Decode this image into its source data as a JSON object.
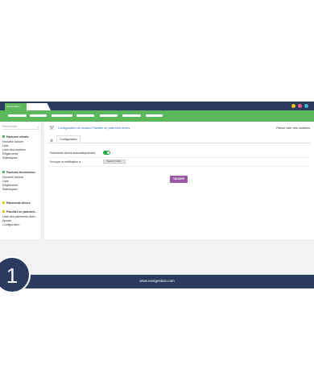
{
  "app": {
    "brand_tab": "NextGestion"
  },
  "window_dots": [
    "#f1c40f",
    "#e85d8a",
    "#3fb2d6"
  ],
  "sidebar": {
    "search_placeholder": "Rechercher",
    "sections": [
      {
        "title": "Factures clients",
        "color": "#5cb85c",
        "items": [
          "Nouvelle facture",
          "Liste",
          "Liste des modèles",
          "Règlements",
          "Statistiques"
        ]
      },
      {
        "title": "Factures fournisseur",
        "color": "#5cb85c",
        "items": [
          "Nouvelle facture",
          "Liste",
          "Règlements",
          "Statistiques"
        ]
      },
      {
        "title": "Paiements divers",
        "color": "#f1c40f",
        "items": []
      },
      {
        "title": "Planifier un paiemen...",
        "color": "#f1c40f",
        "items": [
          "Liste des paiements diver...",
          "Ajouter",
          "Configuration"
        ]
      }
    ]
  },
  "main": {
    "title": "Configuration du module Planifier un paiement divers",
    "back_link": "Retour liste des modules",
    "tab_label": "Configuration",
    "rows": [
      {
        "label": "Paiements divers automatiquement",
        "toggle_on": true
      },
      {
        "label": "Envoyer la notification à",
        "select_value": "- Selectz Utilis"
      }
    ],
    "validate_label": "VALIDER"
  },
  "footer": {
    "text": "www.nextgestion.com",
    "step_number": "1"
  }
}
